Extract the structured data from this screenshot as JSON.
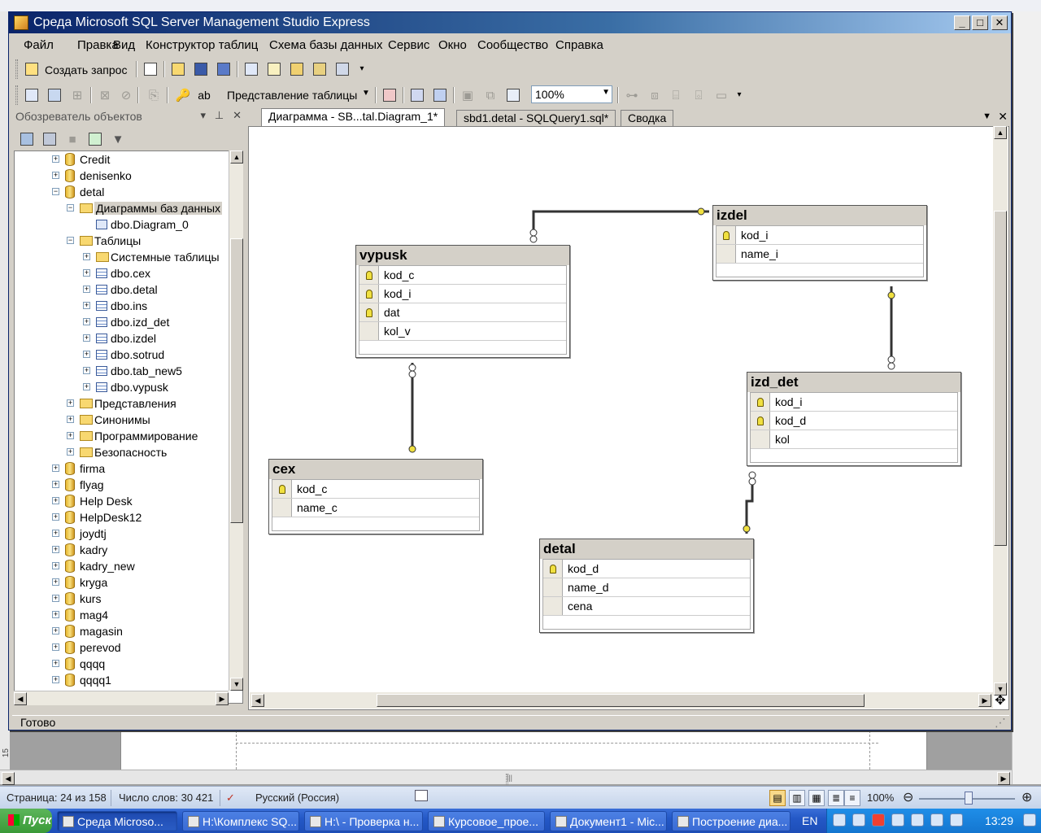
{
  "window": {
    "title": "Среда Microsoft SQL Server Management Studio Express"
  },
  "menu": [
    "Файл",
    "Правка",
    "Вид",
    "Конструктор таблиц",
    "Схема базы данных",
    "Сервис",
    "Окно",
    "Сообщество",
    "Справка"
  ],
  "toolbar1": {
    "new_query": "Создать запрос"
  },
  "toolbar2": {
    "view_dropdown": "Представление таблицы",
    "zoom": "100%"
  },
  "object_explorer": {
    "title": "Обозреватель объектов",
    "tree": [
      {
        "label": "Credit",
        "type": "db",
        "level": 0,
        "expander": "+"
      },
      {
        "label": "denisenko",
        "type": "db",
        "level": 0,
        "expander": "+"
      },
      {
        "label": "detal",
        "type": "db",
        "level": 0,
        "expander": "-"
      },
      {
        "label": "Диаграммы баз данных",
        "type": "folder",
        "level": 1,
        "expander": "-",
        "selected": true
      },
      {
        "label": "dbo.Diagram_0",
        "type": "diagram",
        "level": 2,
        "expander": ""
      },
      {
        "label": "Таблицы",
        "type": "folder",
        "level": 1,
        "expander": "-"
      },
      {
        "label": "Системные таблицы",
        "type": "folder",
        "level": 2,
        "expander": "+"
      },
      {
        "label": "dbo.cex",
        "type": "table",
        "level": 2,
        "expander": "+"
      },
      {
        "label": "dbo.detal",
        "type": "table",
        "level": 2,
        "expander": "+"
      },
      {
        "label": "dbo.ins",
        "type": "table",
        "level": 2,
        "expander": "+"
      },
      {
        "label": "dbo.izd_det",
        "type": "table",
        "level": 2,
        "expander": "+"
      },
      {
        "label": "dbo.izdel",
        "type": "table",
        "level": 2,
        "expander": "+"
      },
      {
        "label": "dbo.sotrud",
        "type": "table",
        "level": 2,
        "expander": "+"
      },
      {
        "label": "dbo.tab_new5",
        "type": "table",
        "level": 2,
        "expander": "+"
      },
      {
        "label": "dbo.vypusk",
        "type": "table",
        "level": 2,
        "expander": "+"
      },
      {
        "label": "Представления",
        "type": "folder",
        "level": 1,
        "expander": "+"
      },
      {
        "label": "Синонимы",
        "type": "folder",
        "level": 1,
        "expander": "+"
      },
      {
        "label": "Программирование",
        "type": "folder",
        "level": 1,
        "expander": "+"
      },
      {
        "label": "Безопасность",
        "type": "folder",
        "level": 1,
        "expander": "+"
      },
      {
        "label": "firma",
        "type": "db",
        "level": 0,
        "expander": "+"
      },
      {
        "label": "flyag",
        "type": "db",
        "level": 0,
        "expander": "+"
      },
      {
        "label": "Help Desk",
        "type": "db",
        "level": 0,
        "expander": "+"
      },
      {
        "label": "HelpDesk12",
        "type": "db",
        "level": 0,
        "expander": "+"
      },
      {
        "label": "joydtj",
        "type": "db",
        "level": 0,
        "expander": "+"
      },
      {
        "label": "kadry",
        "type": "db",
        "level": 0,
        "expander": "+"
      },
      {
        "label": "kadry_new",
        "type": "db",
        "level": 0,
        "expander": "+"
      },
      {
        "label": "kryga",
        "type": "db",
        "level": 0,
        "expander": "+"
      },
      {
        "label": "kurs",
        "type": "db",
        "level": 0,
        "expander": "+"
      },
      {
        "label": "mag4",
        "type": "db",
        "level": 0,
        "expander": "+"
      },
      {
        "label": "magasin",
        "type": "db",
        "level": 0,
        "expander": "+"
      },
      {
        "label": "perevod",
        "type": "db",
        "level": 0,
        "expander": "+"
      },
      {
        "label": "qqqq",
        "type": "db",
        "level": 0,
        "expander": "+"
      },
      {
        "label": "qqqq1",
        "type": "db",
        "level": 0,
        "expander": "+"
      }
    ]
  },
  "doc_tabs": [
    "Диаграмма - SB...tal.Diagram_1*",
    "sbd1.detal - SQLQuery1.sql*",
    "Сводка"
  ],
  "diagram": {
    "tables": [
      {
        "name": "izdel",
        "columns": [
          {
            "name": "kod_i",
            "pk": true
          },
          {
            "name": "name_i",
            "pk": false
          }
        ]
      },
      {
        "name": "vypusk",
        "columns": [
          {
            "name": "kod_c",
            "pk": true
          },
          {
            "name": "kod_i",
            "pk": true
          },
          {
            "name": "dat",
            "pk": true
          },
          {
            "name": "kol_v",
            "pk": false
          }
        ]
      },
      {
        "name": "izd_det",
        "columns": [
          {
            "name": "kod_i",
            "pk": true
          },
          {
            "name": "kod_d",
            "pk": true
          },
          {
            "name": "kol",
            "pk": false
          }
        ]
      },
      {
        "name": "cex",
        "columns": [
          {
            "name": "kod_c",
            "pk": true
          },
          {
            "name": "name_c",
            "pk": false
          }
        ]
      },
      {
        "name": "detal",
        "columns": [
          {
            "name": "kod_d",
            "pk": true
          },
          {
            "name": "name_d",
            "pk": false
          },
          {
            "name": "cena",
            "pk": false
          }
        ]
      }
    ]
  },
  "status": {
    "ready": "Готово"
  },
  "word_status": {
    "page": "Страница: 24 из 158",
    "words": "Число слов: 30 421",
    "language": "Русский (Россия)",
    "zoom": "100%",
    "ruler_number": "15"
  },
  "taskbar": {
    "start": "Пуск",
    "tasks": [
      "Среда Microso...",
      "H:\\Комплекс SQ...",
      "H:\\ - Проверка н...",
      "Курсовое_прое...",
      "Документ1 - Mic...",
      "Построение диа..."
    ],
    "lang": "EN",
    "clock": "13:29"
  },
  "colors": {
    "key_yellow": "#f0e040",
    "titlebar": "#0a246a",
    "taskbar": "#2458c6"
  }
}
